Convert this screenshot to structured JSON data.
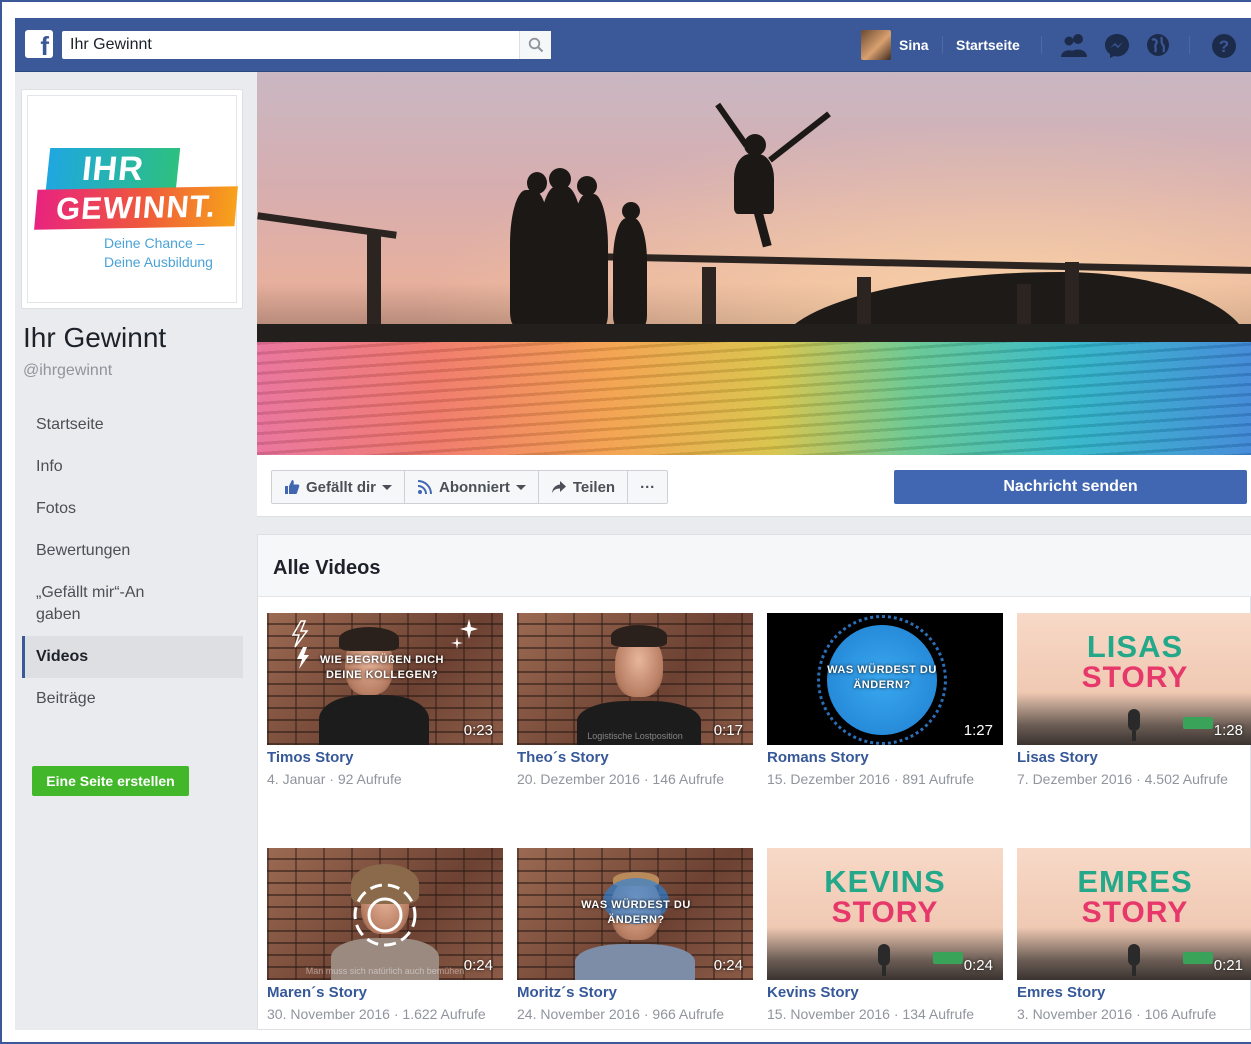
{
  "topbar": {
    "logo": "f",
    "search_value": "Ihr Gewinnt",
    "user_name": "Sina",
    "home_label": "Startseite",
    "icons": [
      "friends-icon",
      "messenger-icon",
      "globe-notifications-icon",
      "help-icon"
    ]
  },
  "page": {
    "logo_line1": "IHR",
    "logo_line2": "GEWINNT.",
    "logo_sub1": "Deine Chance –",
    "logo_sub2": "Deine Ausbildung",
    "name": "Ihr Gewinnt",
    "handle": "@ihrgewinnt"
  },
  "nav": [
    {
      "label": "Startseite",
      "active": false
    },
    {
      "label": "Info",
      "active": false
    },
    {
      "label": "Fotos",
      "active": false
    },
    {
      "label": "Bewertungen",
      "active": false
    },
    {
      "label": "„Gefällt mir“-Angaben",
      "active": false
    },
    {
      "label": "Videos",
      "active": true
    },
    {
      "label": "Beiträge",
      "active": false
    }
  ],
  "create_page_label": "Eine Seite erstellen",
  "actions": {
    "like": "Gefällt dir",
    "follow": "Abonniert",
    "share": "Teilen",
    "more": "···",
    "message": "Nachricht senden"
  },
  "videos": {
    "title": "Alle Videos",
    "items": [
      {
        "title": "Timos Story",
        "meta": "4. Januar · 92 Aufrufe",
        "duration": "0:23",
        "overlay": "WIE BEGRÜßEN DICH DEINE KOLLEGEN?"
      },
      {
        "title": "Theo´s Story",
        "meta": "20. Dezember 2016 · 146 Aufrufe",
        "duration": "0:17",
        "overlay": "Logistische Lostposition"
      },
      {
        "title": "Romans Story",
        "meta": "15. Dezember 2016 · 891 Aufrufe",
        "duration": "1:27",
        "overlay": "WAS WÜRDEST DU ÄNDERN?"
      },
      {
        "title": "Lisas Story",
        "meta": "7. Dezember 2016 · 4.502 Aufrufe",
        "duration": "1:28",
        "overlay1": "LISAS",
        "overlay2": "STORY"
      },
      {
        "title": "Maren´s Story",
        "meta": "30. November 2016 · 1.622 Aufrufe",
        "duration": "0:24",
        "overlay": "Man muss sich natürlich auch bemühen"
      },
      {
        "title": "Moritz´s Story",
        "meta": "24. November 2016 · 966 Aufrufe",
        "duration": "0:24",
        "overlay": "WAS WÜRDEST DU ÄNDERN?"
      },
      {
        "title": "Kevins Story",
        "meta": "15. November 2016 · 134 Aufrufe",
        "duration": "0:24",
        "overlay1": "KEVINS",
        "overlay2": "STORY"
      },
      {
        "title": "Emres Story",
        "meta": "3. November 2016 · 106 Aufrufe",
        "duration": "0:21",
        "overlay1": "EMRES",
        "overlay2": "STORY"
      }
    ]
  },
  "colors": {
    "brand_blue": "#3b5998",
    "link_blue": "#365899",
    "button_blue": "#4267b2",
    "green": "#42b72a",
    "background": "#e9ebee"
  }
}
